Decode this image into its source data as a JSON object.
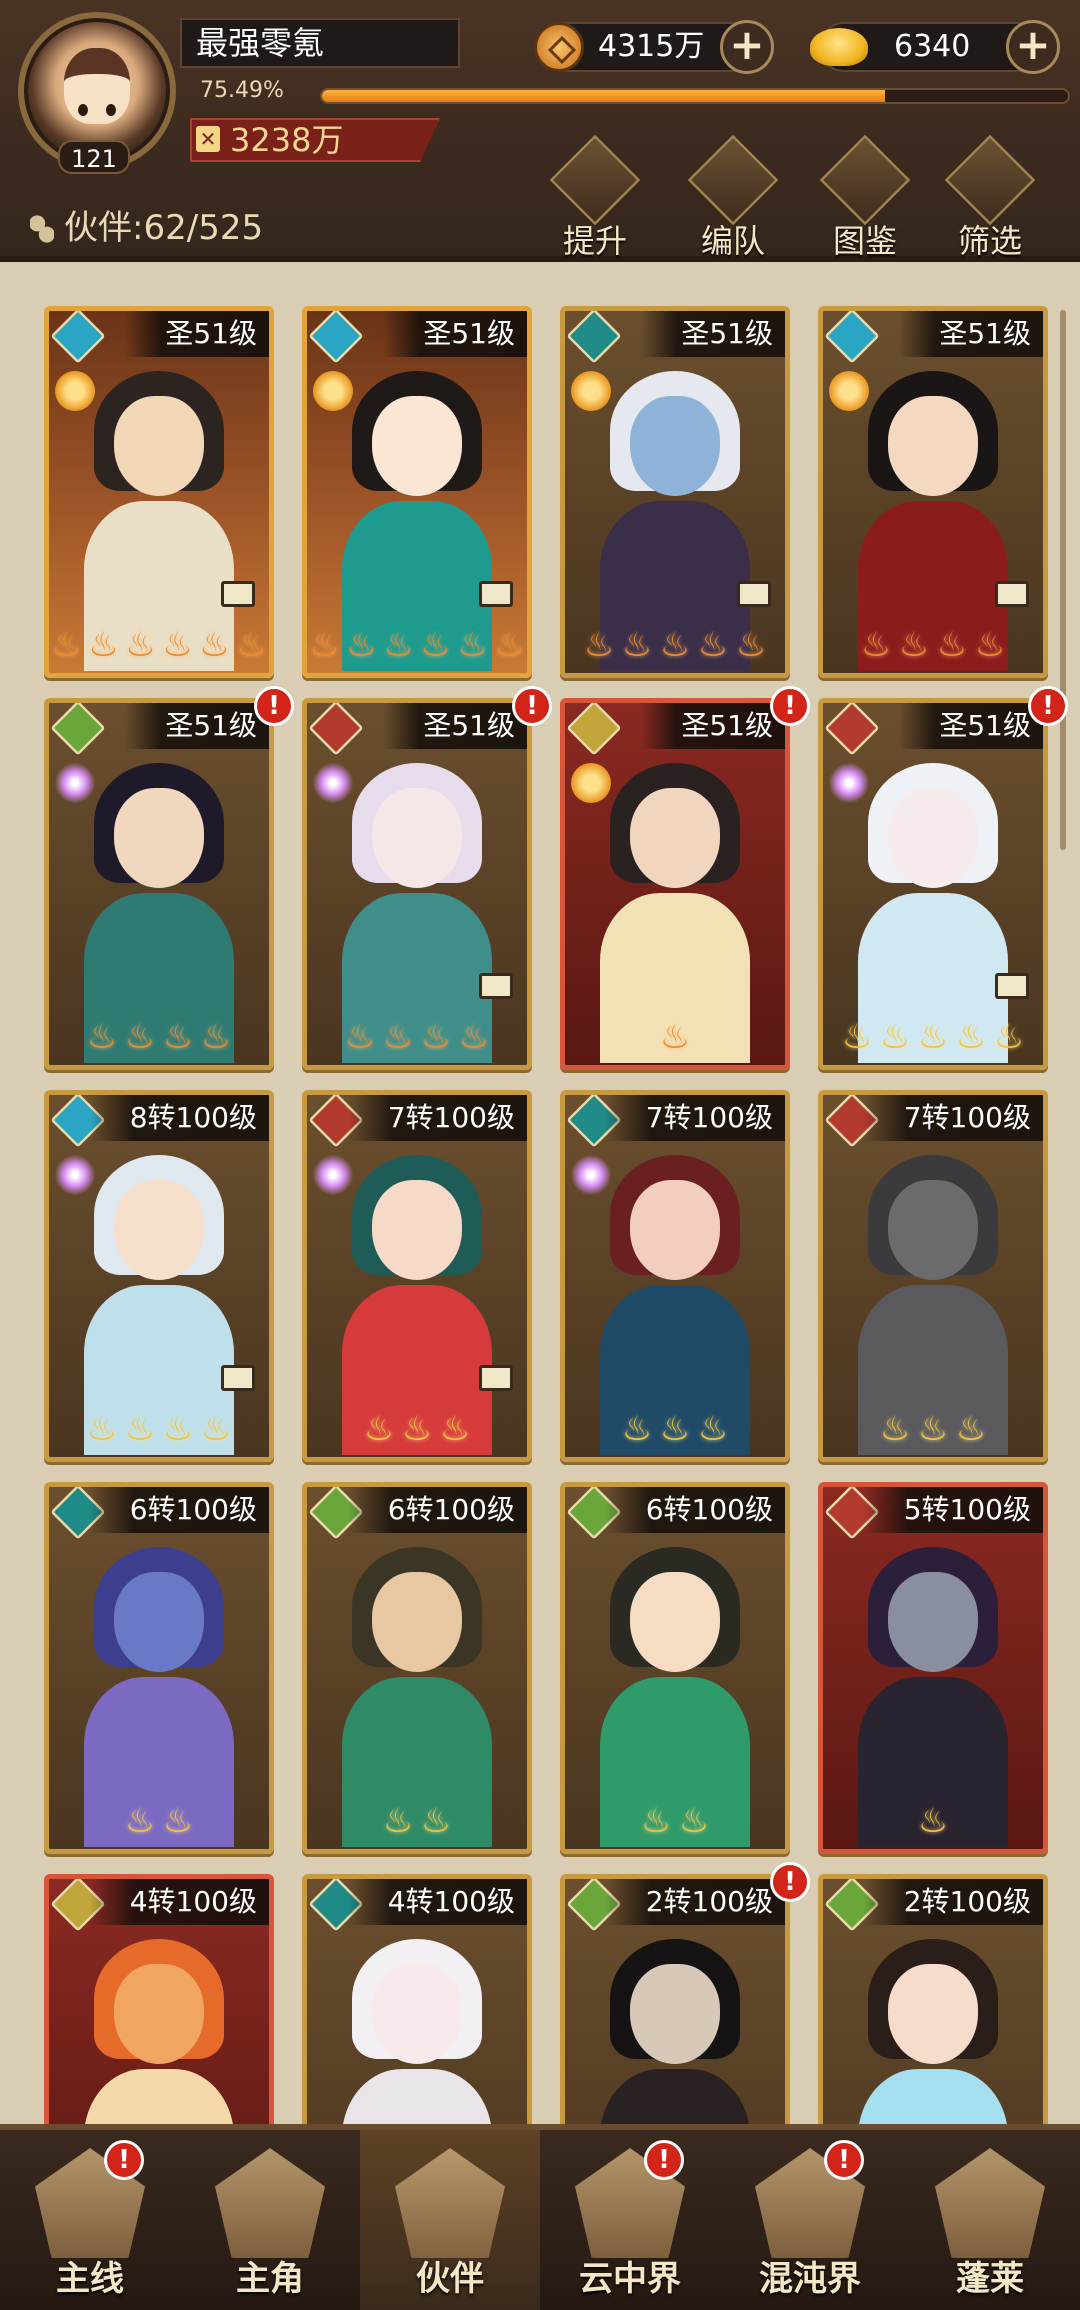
{
  "player": {
    "name": "最强零氪",
    "level": "121",
    "exp_percent": "75.49%",
    "exp_value": 0.7549,
    "power": "3238万"
  },
  "currencies": {
    "copper": "4315万",
    "gold": "6340"
  },
  "partners": {
    "label": "伙伴:",
    "count": "62/525"
  },
  "actions": [
    {
      "label": "提升",
      "icon": "upgrade-icon"
    },
    {
      "label": "编队",
      "icon": "formation-flag-icon"
    },
    {
      "label": "图鉴",
      "icon": "scroll-icon"
    },
    {
      "label": "筛选",
      "icon": "filter-icon"
    }
  ],
  "cards": [
    {
      "level": "圣51级",
      "element": "water",
      "class": "lotus",
      "stars": 6,
      "star_color": "orange",
      "frame": "gold",
      "equip": true,
      "alert": false,
      "skin": "#f1d7b5",
      "hair": "#2b2420",
      "body": "#e9dfc6"
    },
    {
      "level": "圣51级",
      "element": "water",
      "class": "moon",
      "stars": 6,
      "star_color": "orange",
      "frame": "gold",
      "equip": true,
      "alert": false,
      "skin": "#fae6d2",
      "hair": "#1f1a18",
      "body": "#1e9a8e"
    },
    {
      "level": "圣51级",
      "element": "dark",
      "class": "lotus",
      "stars": 5,
      "star_color": "orange",
      "frame": "normal",
      "equip": true,
      "alert": false,
      "skin": "#8fb2d8",
      "hair": "#e6e8ef",
      "body": "#3a2e48"
    },
    {
      "level": "圣51级",
      "element": "water",
      "class": "lotus",
      "stars": 4,
      "star_color": "orange",
      "frame": "normal",
      "equip": true,
      "alert": false,
      "skin": "#f4d8c0",
      "hair": "#1b1616",
      "body": "#8a1d1c"
    },
    {
      "level": "圣51级",
      "element": "wind",
      "class": "spark",
      "stars": 4,
      "star_color": "orange",
      "frame": "normal",
      "equip": false,
      "alert": true,
      "skin": "#f1d7bd",
      "hair": "#1e1a2a",
      "body": "#2f7b73"
    },
    {
      "level": "圣51级",
      "element": "demon",
      "class": "spark",
      "stars": 4,
      "star_color": "orange",
      "frame": "normal",
      "equip": true,
      "alert": true,
      "skin": "#f6e6e6",
      "hair": "#e7dcec",
      "body": "#3f8e8a"
    },
    {
      "level": "圣51级",
      "element": "gold",
      "class": "lotus",
      "stars": 1,
      "star_color": "orange",
      "frame": "red",
      "equip": false,
      "alert": true,
      "skin": "#f2d5bf",
      "hair": "#2a2220",
      "body": "#f3e1b6"
    },
    {
      "level": "圣51级",
      "element": "demon",
      "class": "spark",
      "stars": 5,
      "star_color": "gold",
      "frame": "normal",
      "equip": true,
      "alert": true,
      "skin": "#f7ecec",
      "hair": "#eef1f6",
      "body": "#cfe8f2"
    },
    {
      "level": "8转100级",
      "element": "water",
      "class": "spark",
      "stars": 4,
      "star_color": "gold",
      "frame": "normal",
      "equip": true,
      "alert": false,
      "skin": "#f6e0cc",
      "hair": "#dfe7ef",
      "body": "#bfe0ea"
    },
    {
      "level": "7转100级",
      "element": "demon",
      "class": "spark",
      "stars": 3,
      "star_color": "gold",
      "frame": "normal",
      "equip": true,
      "alert": false,
      "skin": "#f7d9c7",
      "hair": "#1f5c58",
      "body": "#d63a3a"
    },
    {
      "level": "7转100级",
      "element": "dark",
      "class": "spark",
      "stars": 3,
      "star_color": "gold",
      "frame": "normal",
      "equip": false,
      "alert": false,
      "skin": "#f3cdbd",
      "hair": "#6a2020",
      "body": "#1f4b66"
    },
    {
      "level": "7转100级",
      "element": "demon",
      "class": "none",
      "stars": 3,
      "star_color": "gold",
      "frame": "normal",
      "equip": false,
      "alert": false,
      "skin": "#6b6b6e",
      "hair": "#3b3b3e",
      "body": "#5a5a5e"
    },
    {
      "level": "6转100级",
      "element": "dark",
      "class": "none",
      "stars": 2,
      "star_color": "gold",
      "frame": "normal",
      "equip": false,
      "alert": false,
      "skin": "#6a78c8",
      "hair": "#3d3f8e",
      "body": "#7c6ac2"
    },
    {
      "level": "6转100级",
      "element": "wind",
      "class": "none",
      "stars": 2,
      "star_color": "gold",
      "frame": "normal",
      "equip": false,
      "alert": false,
      "skin": "#e8c7a3",
      "hair": "#3b3526",
      "body": "#2f8a66"
    },
    {
      "level": "6转100级",
      "element": "wind",
      "class": "none",
      "stars": 2,
      "star_color": "gold",
      "frame": "normal",
      "equip": false,
      "alert": false,
      "skin": "#f5dcc2",
      "hair": "#2b2a22",
      "body": "#2f9a6a"
    },
    {
      "level": "5转100级",
      "element": "demon",
      "class": "none",
      "stars": 1,
      "star_color": "gold",
      "frame": "red",
      "equip": false,
      "alert": false,
      "skin": "#8a8fa0",
      "hair": "#2b1f3a",
      "body": "#2a2330"
    },
    {
      "level": "4转100级",
      "element": "gold",
      "class": "none",
      "stars": 0,
      "star_color": "gold",
      "frame": "red",
      "equip": false,
      "alert": false,
      "skin": "#f0a560",
      "hair": "#e66a2a",
      "body": "#f4d9a8"
    },
    {
      "level": "4转100级",
      "element": "dark",
      "class": "none",
      "stars": 0,
      "star_color": "gold",
      "frame": "normal",
      "equip": false,
      "alert": false,
      "skin": "#f8eaea",
      "hair": "#f2f0f2",
      "body": "#e9e4ea"
    },
    {
      "level": "2转100级",
      "element": "wind",
      "class": "none",
      "stars": 0,
      "star_color": "gold",
      "frame": "normal",
      "equip": false,
      "alert": true,
      "skin": "#d8c8b8",
      "hair": "#151313",
      "body": "#2a2222"
    },
    {
      "level": "2转100级",
      "element": "wind",
      "class": "none",
      "stars": 0,
      "star_color": "gold",
      "frame": "normal",
      "equip": false,
      "alert": false,
      "skin": "#f7dccb",
      "hair": "#2a1e1a",
      "body": "#a6dff0"
    }
  ],
  "nav": [
    {
      "label": "主线",
      "icon": "crossed-swords-icon",
      "active": false,
      "alert": true
    },
    {
      "label": "主角",
      "icon": "hero-icon",
      "active": false,
      "alert": false
    },
    {
      "label": "伙伴",
      "icon": "partner-helmet-icon",
      "active": true,
      "alert": false
    },
    {
      "label": "云中界",
      "icon": "cloud-temple-icon",
      "active": false,
      "alert": true
    },
    {
      "label": "混沌界",
      "icon": "chaos-tower-icon",
      "active": false,
      "alert": true
    },
    {
      "label": "蓬莱",
      "icon": "penglai-sage-icon",
      "active": false,
      "alert": false
    }
  ],
  "badges": {
    "alert_mark": "!",
    "plus": "+",
    "star": "♨"
  }
}
